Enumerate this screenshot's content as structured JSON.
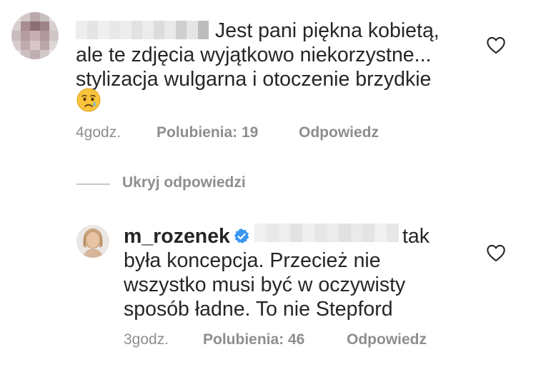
{
  "comment": {
    "line1": "Jest pani piękna kobietą,",
    "line2": "ale te zdjęcia wyjątkowo niekorzystne...",
    "line3": "stylizacja wulgarna i otoczenie brzydkie",
    "emoji": "crying-face",
    "time": "4godz.",
    "likes": "Polubienia: 19",
    "reply_action": "Odpowiedz"
  },
  "hide_replies": "Ukryj odpowiedzi",
  "reply": {
    "username": "m_rozenek",
    "line1_text": "tak",
    "line2": "była koncepcja. Przecież nie",
    "line3": "wszystko musi być w oczywisty",
    "line4": "sposób ładne. To nie Stepford",
    "time": "3godz.",
    "likes": "Polubienia: 46",
    "reply_action": "Odpowiedz"
  },
  "colors": {
    "text": "#262626",
    "secondary": "#8e8e8e",
    "verified": "#3897f0"
  }
}
